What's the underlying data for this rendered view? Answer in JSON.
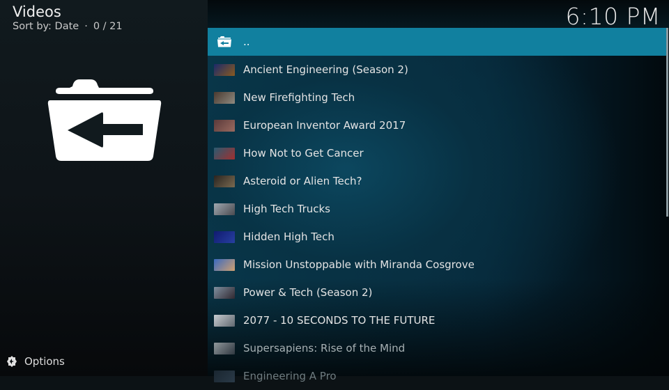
{
  "header": {
    "title": "Videos",
    "sort_label": "Sort by: Date",
    "separator": "·",
    "position": "0 / 21"
  },
  "clock": "6:10 PM",
  "big_icon": "folder-back-icon",
  "options": {
    "label": "Options",
    "icon": "options-gear-icon"
  },
  "list": {
    "parent": {
      "label": "..",
      "icon": "folder-back-icon"
    },
    "items": [
      {
        "label": "Ancient Engineering (Season 2)",
        "thumb_colors": [
          "#1b2a6a",
          "#8a5a20"
        ]
      },
      {
        "label": "New Firefighting Tech",
        "thumb_colors": [
          "#4a3a30",
          "#8f8a80"
        ]
      },
      {
        "label": "European Inventor Award 2017",
        "thumb_colors": [
          "#5a3a3a",
          "#9a6a60"
        ]
      },
      {
        "label": "How Not to Get Cancer",
        "thumb_colors": [
          "#2a5a70",
          "#a03030"
        ]
      },
      {
        "label": "Asteroid or Alien Tech?",
        "thumb_colors": [
          "#2a2420",
          "#7a6a50"
        ]
      },
      {
        "label": "High Tech Trucks",
        "thumb_colors": [
          "#a0a8b0",
          "#4a4a50"
        ]
      },
      {
        "label": "Hidden High Tech",
        "thumb_colors": [
          "#101a70",
          "#2840a0"
        ]
      },
      {
        "label": "Mission Unstoppable with Miranda Cosgrove",
        "thumb_colors": [
          "#3a6ac0",
          "#d0a070"
        ]
      },
      {
        "label": "Power & Tech (Season 2)",
        "thumb_colors": [
          "#8090a0",
          "#302830"
        ]
      },
      {
        "label": "2077 - 10 SECONDS TO THE FUTURE",
        "thumb_colors": [
          "#c8ccd0",
          "#606870"
        ]
      },
      {
        "label": "Supersapiens: Rise of the Mind",
        "thumb_colors": [
          "#90989c",
          "#303840"
        ]
      },
      {
        "label": "Engineering A Pro",
        "thumb_colors": [
          "#1a2630",
          "#2a3a48"
        ]
      }
    ]
  },
  "colors": {
    "accent": "#11809f",
    "scrollbar": "#8a9aa0"
  }
}
